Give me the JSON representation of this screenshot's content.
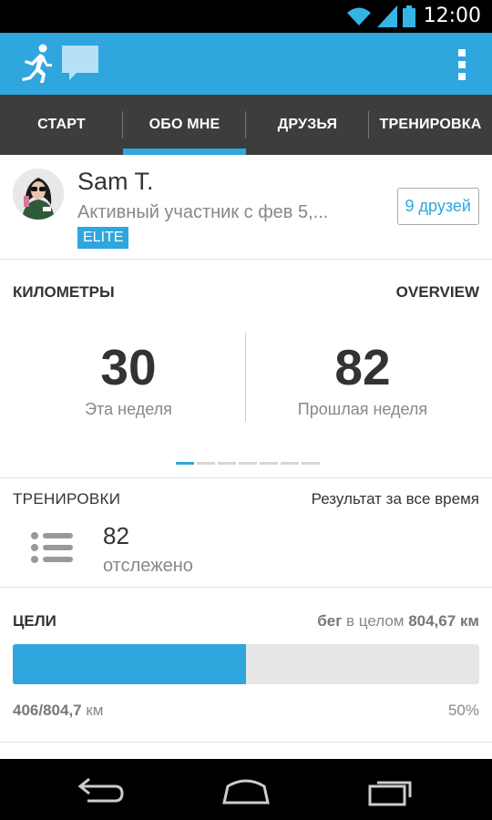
{
  "status": {
    "time": "12:00"
  },
  "tabs": [
    {
      "label": "СТАРТ"
    },
    {
      "label": "ОБО МНЕ"
    },
    {
      "label": "ДРУЗЬЯ"
    },
    {
      "label": "ТРЕНИРОВКА"
    }
  ],
  "profile": {
    "name": "Sam T.",
    "since": "Активный участник с фев 5,...",
    "badge": "ELITE",
    "friends_button": "9 друзей"
  },
  "kilometers": {
    "title": "КИЛОМЕТРЫ",
    "overview": "OVERVIEW",
    "this_week_value": "30",
    "this_week_label": "Эта неделя",
    "last_week_value": "82",
    "last_week_label": "Прошлая неделя",
    "pager_pages": 7,
    "pager_active": 0
  },
  "workouts": {
    "title": "ТРЕНИРОВКИ",
    "all_time": "Результат за все время",
    "count": "82",
    "tracked_label": "отслежено"
  },
  "goals": {
    "title": "ЦЕЛИ",
    "summary_prefix": "бег",
    "summary_middle": " в целом ",
    "summary_total": "804,67 км",
    "progress_done": "406/804,7",
    "progress_unit": " км",
    "percent_label": "50%",
    "progress_fraction": 0.5
  },
  "colors": {
    "accent": "#2fa6de",
    "tabbar": "#3d3d3d"
  },
  "icons": {
    "app_logo": "runner-icon",
    "chat": "chat-bubble-icon",
    "menu": "overflow-menu-icon",
    "workouts": "list-icon"
  }
}
